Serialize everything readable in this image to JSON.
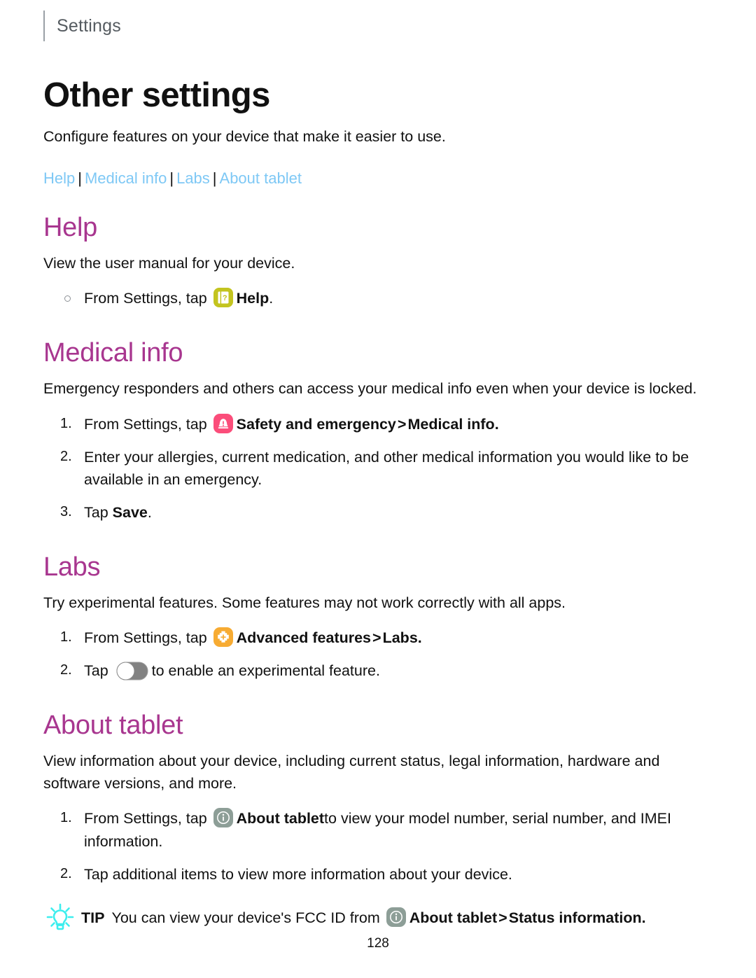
{
  "running_header": {
    "label": "Settings"
  },
  "page": {
    "title": "Other settings",
    "intro": "Configure features on your device that make it easier to use.",
    "folio": "128"
  },
  "jumplinks": {
    "separator": "|",
    "items": [
      {
        "label": "Help"
      },
      {
        "label": "Medical info"
      },
      {
        "label": "Labs"
      },
      {
        "label": "About tablet"
      }
    ]
  },
  "sections": {
    "help": {
      "heading": "Help",
      "intro": "View the user manual for your device.",
      "steps": [
        {
          "marker": "bullet",
          "pre": "From Settings, tap",
          "icon": "help-manual-icon",
          "bold": "Help",
          "post": "."
        }
      ]
    },
    "medical": {
      "heading": "Medical info",
      "intro": "Emergency responders and others can access your medical info even when your device is locked.",
      "steps": [
        {
          "marker": "1.",
          "pre": "From Settings, tap",
          "icon": "safety-emergency-icon",
          "bold": "Safety and emergency",
          "chevron": ">",
          "bold2": "Medical info",
          "post": "."
        },
        {
          "marker": "2.",
          "pre": "Enter your allergies, current medication, and other medical information you would like to be available in an emergency."
        },
        {
          "marker": "3.",
          "pre": "Tap",
          "bold": "Save",
          "post": "."
        }
      ]
    },
    "labs": {
      "heading": "Labs",
      "intro": "Try experimental features. Some features may not work correctly with all apps.",
      "steps": [
        {
          "marker": "1.",
          "pre": "From Settings, tap",
          "icon": "advanced-features-icon",
          "bold": "Advanced features",
          "chevron": ">",
          "bold2": "Labs",
          "post": "."
        },
        {
          "marker": "2.",
          "pre": "Tap",
          "toggle": "off",
          "post": "to enable an experimental feature."
        }
      ]
    },
    "about": {
      "heading": "About tablet",
      "intro": "View information about your device, including current status, legal information, hardware and software versions, and more.",
      "steps": [
        {
          "marker": "1.",
          "pre": "From Settings, tap",
          "icon": "about-tablet-info-icon",
          "bold": "About tablet",
          "post": "to view your model number, serial number, and IMEI information."
        },
        {
          "marker": "2.",
          "pre": "Tap additional items to view more information about your device."
        }
      ]
    }
  },
  "tip": {
    "icon": "lightbulb-icon",
    "word": "TIP",
    "pre": "You can view your device's FCC ID from",
    "icon2": "about-tablet-info-icon",
    "bold": "About tablet",
    "chevron": ">",
    "bold2": "Status information",
    "post": "."
  },
  "colors": {
    "heading_purple": "#a8368f",
    "link_blue": "#7ec8f5",
    "help_icon": "#c3c41f",
    "safety_icon": "#fb4d7a",
    "advanced_icon": "#f7ab32",
    "about_icon": "#8d9e97",
    "tip_cyan": "#3deeee",
    "toggle_track": "#828282",
    "rule_gray": "#9aa0a6"
  }
}
